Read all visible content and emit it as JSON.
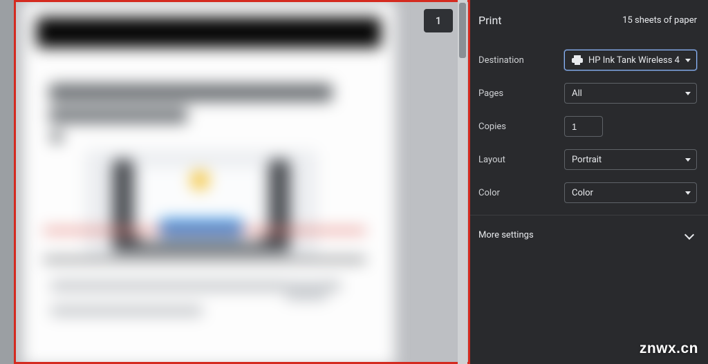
{
  "watermark": "znwx.cn",
  "preview": {
    "page_badge": "1"
  },
  "sidebar": {
    "title": "Print",
    "summary": "15 sheets of paper",
    "rows": {
      "destination": {
        "label": "Destination",
        "value": "HP Ink Tank Wireless 4"
      },
      "pages": {
        "label": "Pages",
        "value": "All"
      },
      "copies": {
        "label": "Copies",
        "value": "1"
      },
      "layout": {
        "label": "Layout",
        "value": "Portrait"
      },
      "color": {
        "label": "Color",
        "value": "Color"
      }
    },
    "more": "More settings"
  }
}
